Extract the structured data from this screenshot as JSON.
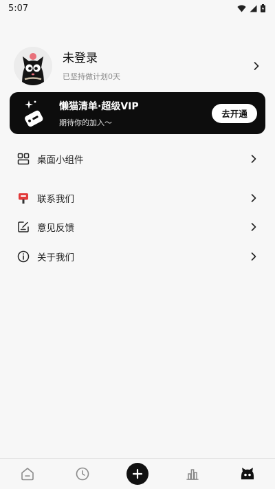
{
  "status_bar": {
    "time": "5:07",
    "icons": [
      "wifi-icon",
      "signal-icon",
      "battery-icon"
    ]
  },
  "profile": {
    "name": "未登录",
    "subtitle": "已坚持做计划0天",
    "avatar_icon": "cat-avatar-icon"
  },
  "vip": {
    "title": "懒猫清单·超级VIP",
    "subtitle": "期待你的加入～",
    "button_label": "去开通",
    "icon": "vip-tag-icon"
  },
  "menu": {
    "widget": {
      "label": "桌面小组件",
      "icon": "widget-grid-icon"
    },
    "contact": {
      "label": "联系我们",
      "icon": "mailbox-icon"
    },
    "feedback": {
      "label": "意见反馈",
      "icon": "edit-note-icon"
    },
    "about": {
      "label": "关于我们",
      "icon": "info-icon"
    }
  },
  "bottom_nav": [
    "home-icon",
    "clock-icon",
    "add-icon",
    "stats-icon",
    "cat-face-icon"
  ],
  "colors": {
    "background": "#f7f7f7",
    "vip_card": "#0d0d0d",
    "accent_red": "#e23a3a"
  }
}
